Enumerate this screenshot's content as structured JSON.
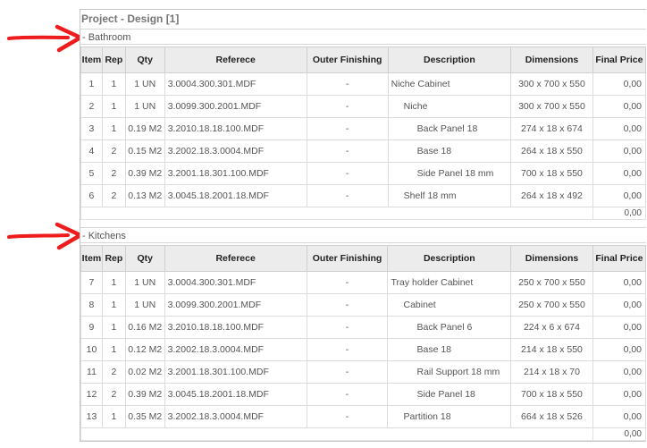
{
  "project_title": "Project - Design [1]",
  "columns": [
    "Item",
    "Rep",
    "Qty",
    "Referece",
    "Outer Finishing",
    "Description",
    "Dimensions",
    "Final Price"
  ],
  "sections": [
    {
      "name": "- Bathroom",
      "rows": [
        {
          "item": "1",
          "rep": "1",
          "qty": "1 UN",
          "ref": "3.0004.300.301.MDF",
          "outer": "-",
          "desc": "Niche Cabinet",
          "indent": 0,
          "dims": "300 x 700 x 550",
          "price": "0,00"
        },
        {
          "item": "2",
          "rep": "1",
          "qty": "1 UN",
          "ref": "3.0099.300.2001.MDF",
          "outer": "-",
          "desc": "Niche",
          "indent": 1,
          "dims": "300 x 700 x 550",
          "price": "0,00"
        },
        {
          "item": "3",
          "rep": "1",
          "qty": "0.19 M2",
          "ref": "3.2010.18.18.100.MDF",
          "outer": "-",
          "desc": "Back Panel 18",
          "indent": 2,
          "dims": "274 x 18 x 674",
          "price": "0,00"
        },
        {
          "item": "4",
          "rep": "2",
          "qty": "0.15 M2",
          "ref": "3.2002.18.3.0004.MDF",
          "outer": "-",
          "desc": "Base 18",
          "indent": 2,
          "dims": "264 x 18 x 550",
          "price": "0,00"
        },
        {
          "item": "5",
          "rep": "2",
          "qty": "0.39 M2",
          "ref": "3.2001.18.301.100.MDF",
          "outer": "-",
          "desc": "Side Panel 18 mm",
          "indent": 2,
          "dims": "700 x 18 x 550",
          "price": "0,00"
        },
        {
          "item": "6",
          "rep": "2",
          "qty": "0.13 M2",
          "ref": "3.0045.18.2001.18.MDF",
          "outer": "-",
          "desc": "Shelf 18 mm",
          "indent": 1,
          "dims": "264 x 18 x 492",
          "price": "0,00"
        }
      ],
      "total": "0,00"
    },
    {
      "name": "- Kitchens",
      "rows": [
        {
          "item": "7",
          "rep": "1",
          "qty": "1 UN",
          "ref": "3.0004.300.301.MDF",
          "outer": "-",
          "desc": "Tray holder Cabinet",
          "indent": 0,
          "dims": "250 x 700 x 550",
          "price": "0,00"
        },
        {
          "item": "8",
          "rep": "1",
          "qty": "1 UN",
          "ref": "3.0099.300.2001.MDF",
          "outer": "-",
          "desc": "Cabinet",
          "indent": 1,
          "dims": "250 x 700 x 550",
          "price": "0,00"
        },
        {
          "item": "9",
          "rep": "1",
          "qty": "0.16 M2",
          "ref": "3.2010.18.18.100.MDF",
          "outer": "-",
          "desc": "Back Panel 6",
          "indent": 2,
          "dims": "224 x 6 x 674",
          "price": "0,00"
        },
        {
          "item": "10",
          "rep": "1",
          "qty": "0.12 M2",
          "ref": "3.2002.18.3.0004.MDF",
          "outer": "-",
          "desc": "Base 18",
          "indent": 2,
          "dims": "214 x 18 x 550",
          "price": "0,00"
        },
        {
          "item": "11",
          "rep": "2",
          "qty": "0.02 M2",
          "ref": "3.2001.18.301.100.MDF",
          "outer": "-",
          "desc": "Rail Support 18 mm",
          "indent": 2,
          "dims": "214 x 18 x 70",
          "price": "0,00"
        },
        {
          "item": "12",
          "rep": "2",
          "qty": "0.39 M2",
          "ref": "3.0045.18.2001.18.MDF",
          "outer": "-",
          "desc": "Side Panel 18",
          "indent": 2,
          "dims": "700 x 18 x 550",
          "price": "0,00"
        },
        {
          "item": "13",
          "rep": "1",
          "qty": "0.35 M2",
          "ref": "3.2002.18.3.0004.MDF",
          "outer": "-",
          "desc": "Partition 18",
          "indent": 1,
          "dims": "664 x 18 x 526",
          "price": "0,00"
        }
      ],
      "total": "0,00"
    }
  ],
  "annotation_color": "#ee1c1c",
  "icons": [
    "arrow-right-icon"
  ]
}
